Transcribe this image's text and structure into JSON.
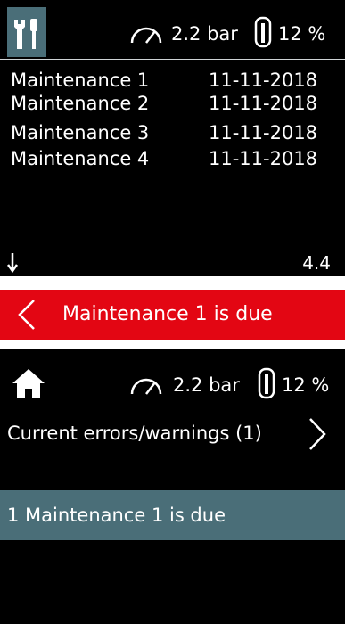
{
  "top_screen": {
    "status": {
      "pressure": "2.2 bar",
      "level": "12 %",
      "icons": [
        "wrench-screwdriver-icon",
        "gauge-icon",
        "thermometer-icon"
      ]
    },
    "rows": [
      {
        "name": "Maintenance 1",
        "date": "11-11-2018"
      },
      {
        "name": "Maintenance 2",
        "date": "11-11-2018"
      },
      {
        "name": "Maintenance 3",
        "date": "11-11-2018"
      },
      {
        "name": "Maintenance 4",
        "date": "11-11-2018"
      }
    ],
    "version": "4.4",
    "scroll_icon": "arrow-down-icon"
  },
  "banner": {
    "text": "Maintenance 1 is due",
    "back_icon": "chevron-left-icon",
    "color": "#e30613"
  },
  "bottom_screen": {
    "status": {
      "pressure": "2.2 bar",
      "level": "12 %",
      "icons": [
        "home-icon",
        "gauge-icon",
        "thermometer-icon"
      ]
    },
    "nav": {
      "label": "Current errors/warnings (1)",
      "icon": "chevron-right-icon"
    },
    "error_item": "1 Maintenance 1 is due",
    "highlight_color": "#4a6e78"
  }
}
